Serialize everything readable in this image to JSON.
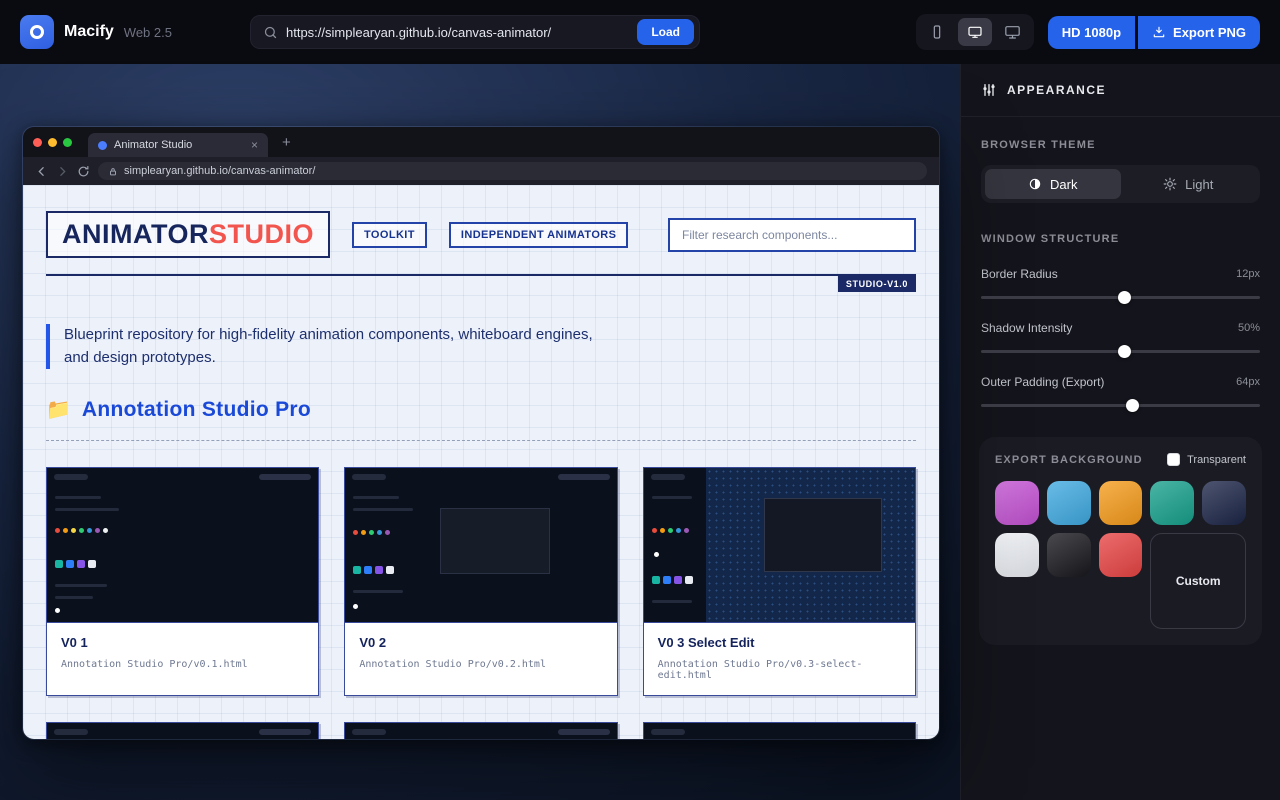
{
  "topbar": {
    "app_name": "Macify",
    "app_version": "Web 2.5",
    "url": "https://simplearyan.github.io/canvas-animator/",
    "load": "Load",
    "hd": "HD 1080p",
    "export": "Export PNG"
  },
  "browser": {
    "tab": "Animator Studio",
    "address": "simplearyan.github.io/canvas-animator/"
  },
  "site": {
    "logo_a": "ANIMATOR",
    "logo_b": "STUDIO",
    "chip_toolkit": "TOOLKIT",
    "chip_independent": "INDEPENDENT ANIMATORS",
    "filter_placeholder": "Filter research components...",
    "version_badge": "STUDIO-V1.0",
    "blurb": "Blueprint repository for high-fidelity animation components, whiteboard engines, and design prototypes.",
    "folder_icon": "📁",
    "section": "Annotation Studio Pro",
    "cards": [
      {
        "title": "V0 1",
        "path": "Annotation Studio Pro/v0.1.html"
      },
      {
        "title": "V0 2",
        "path": "Annotation Studio Pro/v0.2.html"
      },
      {
        "title": "V0 3 Select Edit",
        "path": "Annotation Studio Pro/v0.3-select-edit.html"
      }
    ]
  },
  "sidebar": {
    "header": "APPEARANCE",
    "theme_label": "BROWSER THEME",
    "dark": "Dark",
    "light": "Light",
    "structure_label": "WINDOW STRUCTURE",
    "sliders": [
      {
        "label": "Border Radius",
        "value": "12px"
      },
      {
        "label": "Shadow Intensity",
        "value": "50%"
      },
      {
        "label": "Outer Padding (Export)",
        "value": "64px"
      }
    ],
    "export_label": "EXPORT BACKGROUND",
    "transparent": "Transparent",
    "custom": "Custom",
    "swatches": [
      "#c653d6",
      "#3fa9e0",
      "#f59b1b",
      "#17a08c",
      "#1b2547",
      "#eef1f6",
      "#17171d",
      "#e84444"
    ],
    "accent": "#2563eb"
  }
}
